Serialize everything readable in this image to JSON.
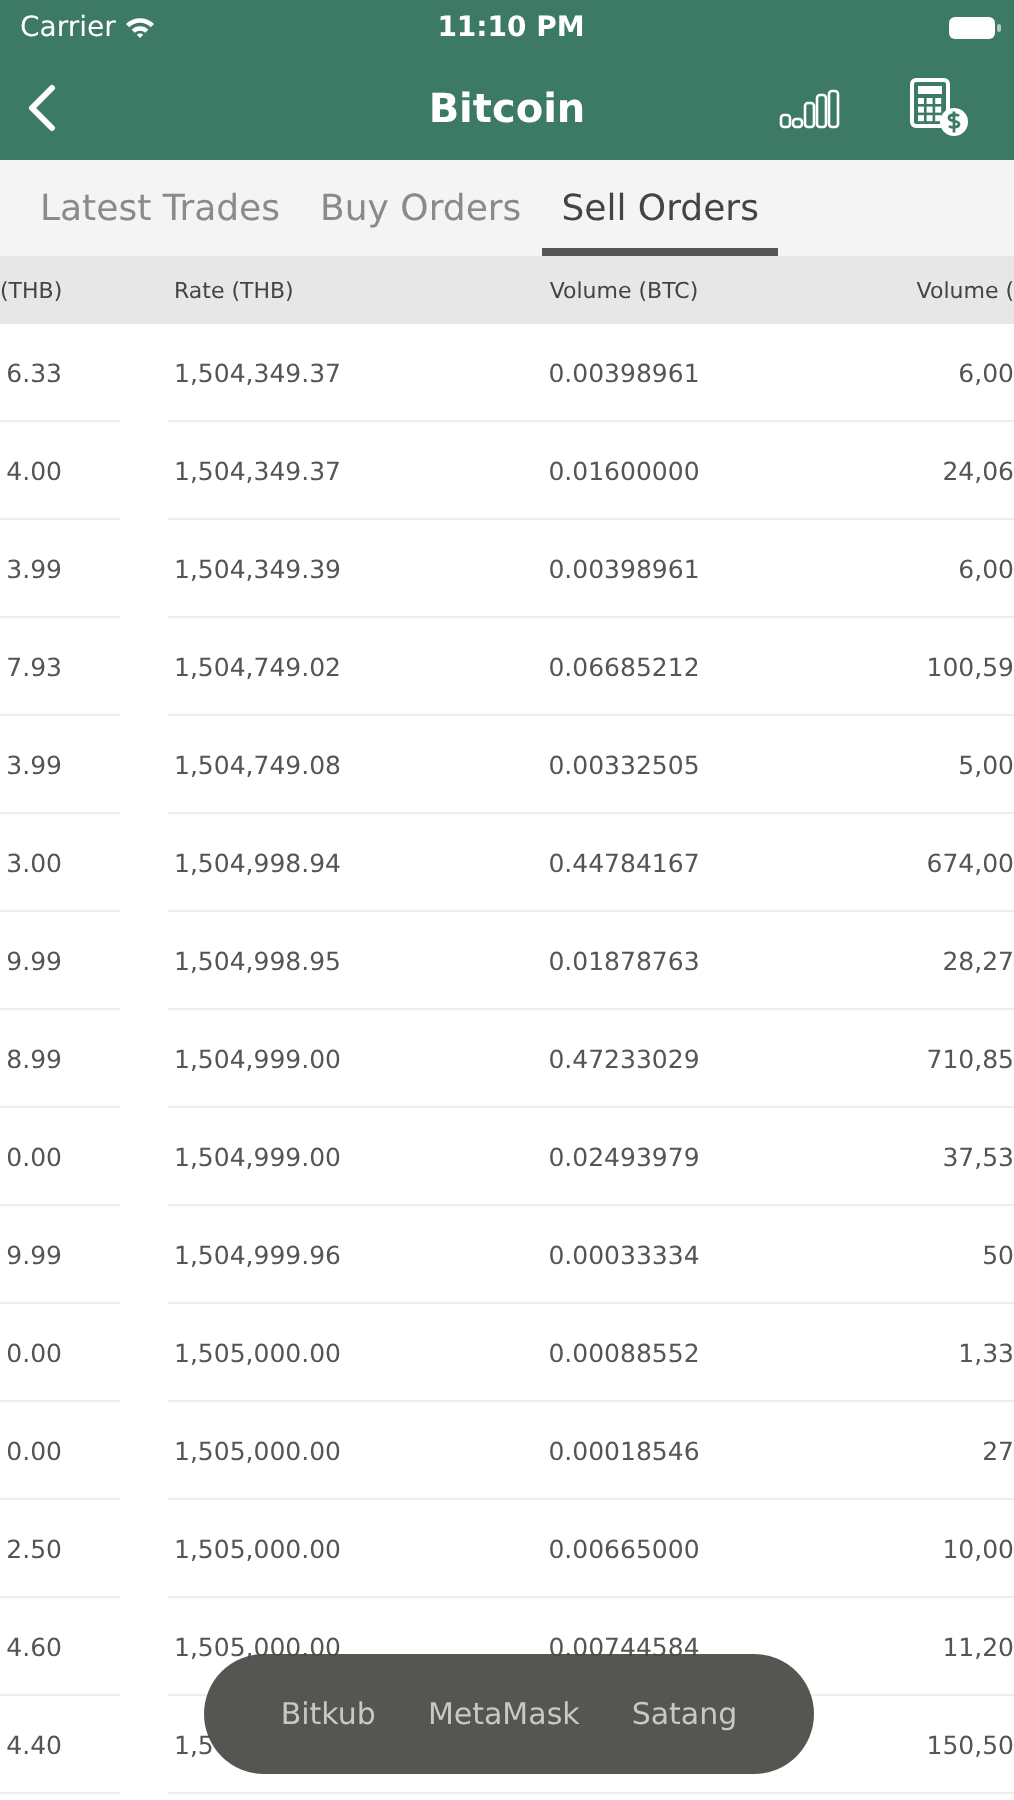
{
  "status_bar": {
    "carrier": "Carrier",
    "time": "11:10 PM"
  },
  "nav_bar": {
    "title": "Bitcoin"
  },
  "tabs": [
    {
      "label": "Latest Trades",
      "selected": false
    },
    {
      "label": "Buy Orders",
      "selected": false
    },
    {
      "label": "Sell Orders",
      "selected": true
    }
  ],
  "table": {
    "columns": [
      "(THB)",
      "Rate (THB)",
      "Volume (BTC)",
      "Volume ("
    ],
    "rows": [
      [
        "6.33",
        "1,504,349.37",
        "0.00398961",
        "6,00"
      ],
      [
        "4.00",
        "1,504,349.37",
        "0.01600000",
        "24,06"
      ],
      [
        "3.99",
        "1,504,349.39",
        "0.00398961",
        "6,00"
      ],
      [
        "7.93",
        "1,504,749.02",
        "0.06685212",
        "100,59"
      ],
      [
        "3.99",
        "1,504,749.08",
        "0.00332505",
        "5,00"
      ],
      [
        "3.00",
        "1,504,998.94",
        "0.44784167",
        "674,00"
      ],
      [
        "9.99",
        "1,504,998.95",
        "0.01878763",
        "28,27"
      ],
      [
        "8.99",
        "1,504,999.00",
        "0.47233029",
        "710,85"
      ],
      [
        "0.00",
        "1,504,999.00",
        "0.02493979",
        "37,53"
      ],
      [
        "9.99",
        "1,504,999.96",
        "0.00033334",
        "50"
      ],
      [
        "0.00",
        "1,505,000.00",
        "0.00088552",
        "1,33"
      ],
      [
        "0.00",
        "1,505,000.00",
        "0.00018546",
        "27"
      ],
      [
        "2.50",
        "1,505,000.00",
        "0.00665000",
        "10,00"
      ],
      [
        "4.60",
        "1,505,000.00",
        "0.00744584",
        "11,20"
      ],
      [
        "4.40",
        "1,5",
        null,
        "150,50"
      ]
    ]
  },
  "overlay_menu": {
    "items": [
      "Bitkub",
      "MetaMask",
      "Satang"
    ]
  }
}
